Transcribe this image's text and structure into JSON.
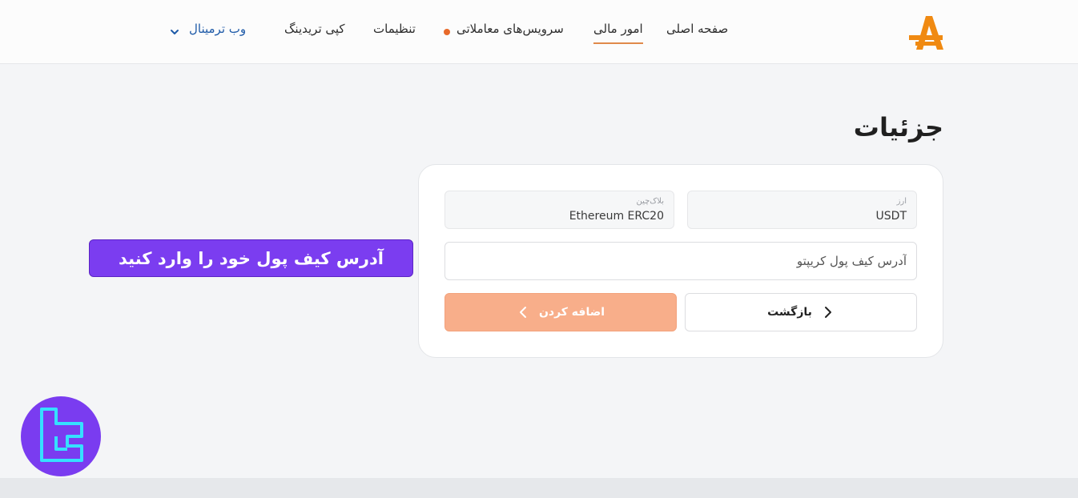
{
  "header": {
    "nav": [
      {
        "label": "صفحه اصلی",
        "active": false
      },
      {
        "label": "امور مالی",
        "active": true
      },
      {
        "label": "سرویس‌های معاملاتی",
        "active": false,
        "has_dot": true
      },
      {
        "label": "تنظیمات",
        "active": false
      },
      {
        "label": "کپی تریدینگ",
        "active": false
      },
      {
        "label": "وب ترمینال",
        "active": false,
        "has_dropdown": true
      }
    ],
    "logo_icon": "brand-a-logo",
    "accent_color": "#e08a4a"
  },
  "main": {
    "title": "جزئیات",
    "currency": {
      "label": "ارز",
      "value": "USDT"
    },
    "blockchain": {
      "label": "بلاک‌چین",
      "value": "Ethereum ERC20"
    },
    "address": {
      "placeholder": "آدرس کیف پول کریپتو",
      "value": ""
    },
    "back_button": "بازگشت",
    "add_button": "اضافه کردن"
  },
  "annotation": {
    "text": "آدرس کیف پول خود را وارد کنید",
    "color": "#7b3df0"
  },
  "watermark": {
    "icon": "tl-watermark-logo"
  }
}
